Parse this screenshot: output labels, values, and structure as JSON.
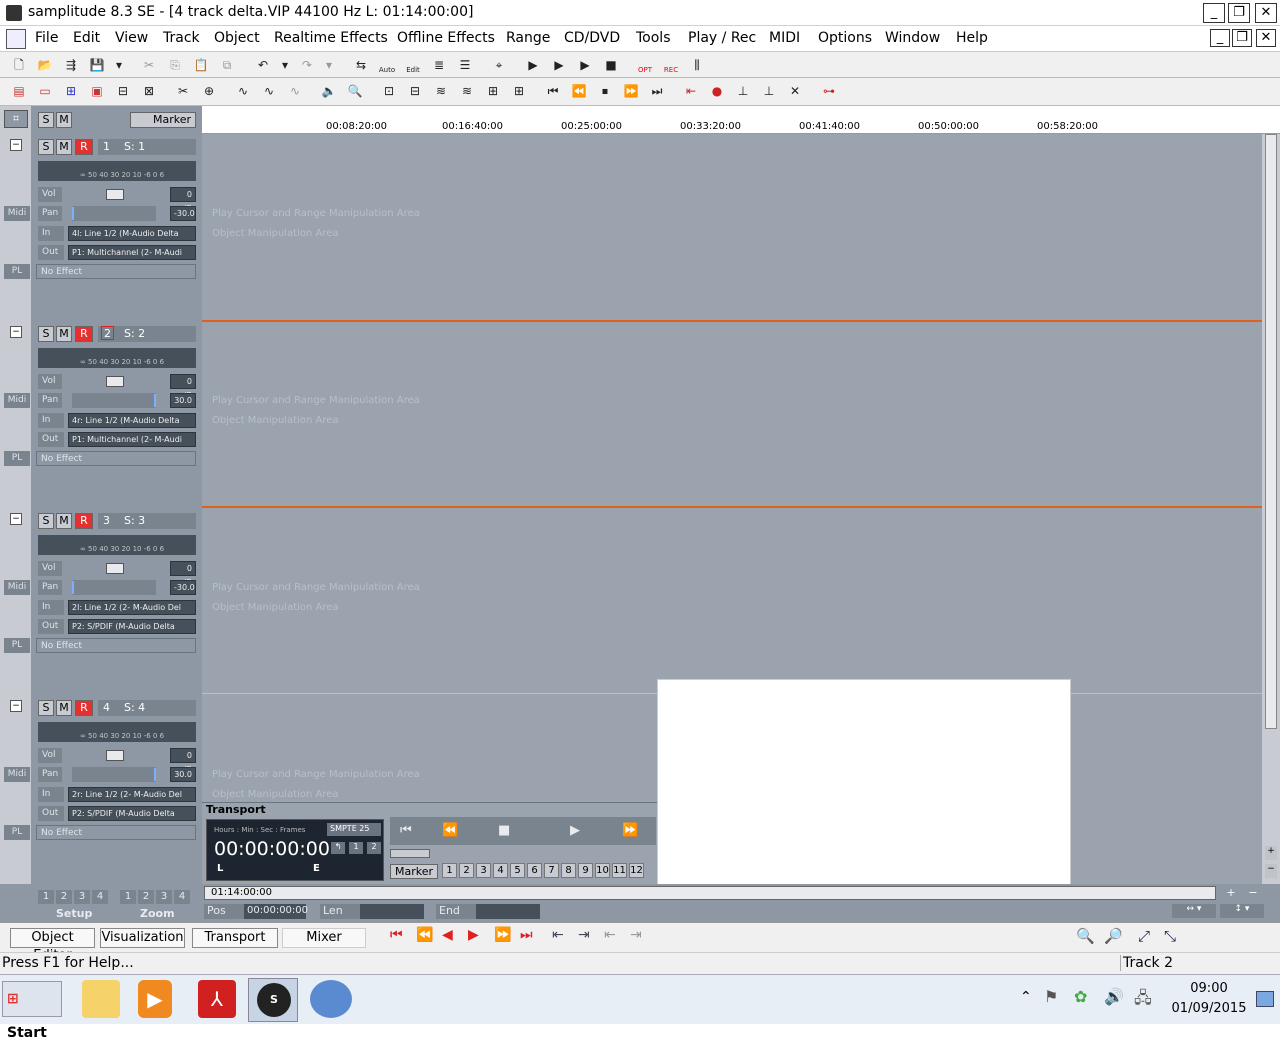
{
  "window": {
    "title": "samplitude 8.3 SE  - [4 track delta.VIP   44100 Hz L: 01:14:00:00]"
  },
  "menu": [
    "File",
    "Edit",
    "View",
    "Track",
    "Object",
    "Realtime Effects",
    "Offline Effects",
    "Range",
    "CD/DVD",
    "Tools",
    "Play / Rec",
    "MIDI",
    "Options",
    "Window",
    "Help"
  ],
  "toolbar": {
    "auto_label": "Auto",
    "edit_label": "Edit",
    "opt_label": "OPT",
    "rec_label": "REC"
  },
  "header": {
    "s": "S",
    "m": "M",
    "marker": "Marker"
  },
  "ruler": [
    "00:08:20:00",
    "00:16:40:00",
    "00:25:00:00",
    "00:33:20:00",
    "00:41:40:00",
    "00:50:00:00",
    "00:58:20:00"
  ],
  "tracks": [
    {
      "num": "1",
      "name": "S: 1",
      "vol": "0 dB",
      "pan": "-30.0",
      "in": "4l: Line 1/2 (M-Audio Delta",
      "out": "P1: Multichannel (2- M-Audi",
      "fx": "No Effect"
    },
    {
      "num": "2",
      "name": "S: 2",
      "vol": "0 dB",
      "pan": "30.0",
      "in": "4r: Line 1/2 (M-Audio Delta",
      "out": "P1: Multichannel (2- M-Audi",
      "fx": "No Effect"
    },
    {
      "num": "3",
      "name": "S: 3",
      "vol": "0 dB",
      "pan": "-30.0",
      "in": "2l: Line 1/2 (2- M-Audio Del",
      "out": "P2: S/PDIF (M-Audio Delta",
      "fx": "No Effect"
    },
    {
      "num": "4",
      "name": "S: 4",
      "vol": "0 dB",
      "pan": "30.0",
      "in": "2r: Line 1/2 (2- M-Audio Del",
      "out": "P2: S/PDIF (M-Audio Delta",
      "fx": "No Effect"
    }
  ],
  "trackctl": {
    "s": "S",
    "m": "M",
    "r": "R",
    "vol": "Vol",
    "pan": "Pan",
    "in": "In",
    "out": "Out",
    "midi": "Midi",
    "pl": "PL",
    "meter": "∞  50 40 30 20  10 -6   0   6"
  },
  "lane": {
    "line1": "Play Cursor and Range Manipulation Area",
    "line2": "Object Manipulation Area"
  },
  "transport": {
    "title": "Transport",
    "hdr": "Hours : Min : Sec : Frames",
    "mode": "SMPTE 25",
    "time": "00:00:00:00",
    "l": "L",
    "e": "E",
    "b1": "1",
    "b2": "2",
    "marker": "Marker",
    "nums": [
      "1",
      "2",
      "3",
      "4",
      "5",
      "6",
      "7",
      "8",
      "9",
      "10",
      "11",
      "12"
    ]
  },
  "bottom": {
    "len_time": "01:14:00:00",
    "pos": "Pos",
    "pos_val": "00:00:00:00",
    "len": "Len",
    "end": "End",
    "setup": "Setup",
    "zoom": "Zoom",
    "setup_nums": [
      "1",
      "2",
      "3",
      "4"
    ],
    "zoom_nums": [
      "1",
      "2",
      "3",
      "4"
    ]
  },
  "tabs": [
    "Object Editor",
    "Visualization",
    "Transport",
    "Mixer"
  ],
  "status": {
    "help": "Press F1 for Help...",
    "track": "Track 2"
  },
  "taskbar": {
    "start": "Start",
    "time": "09:00",
    "date": "01/09/2015"
  }
}
